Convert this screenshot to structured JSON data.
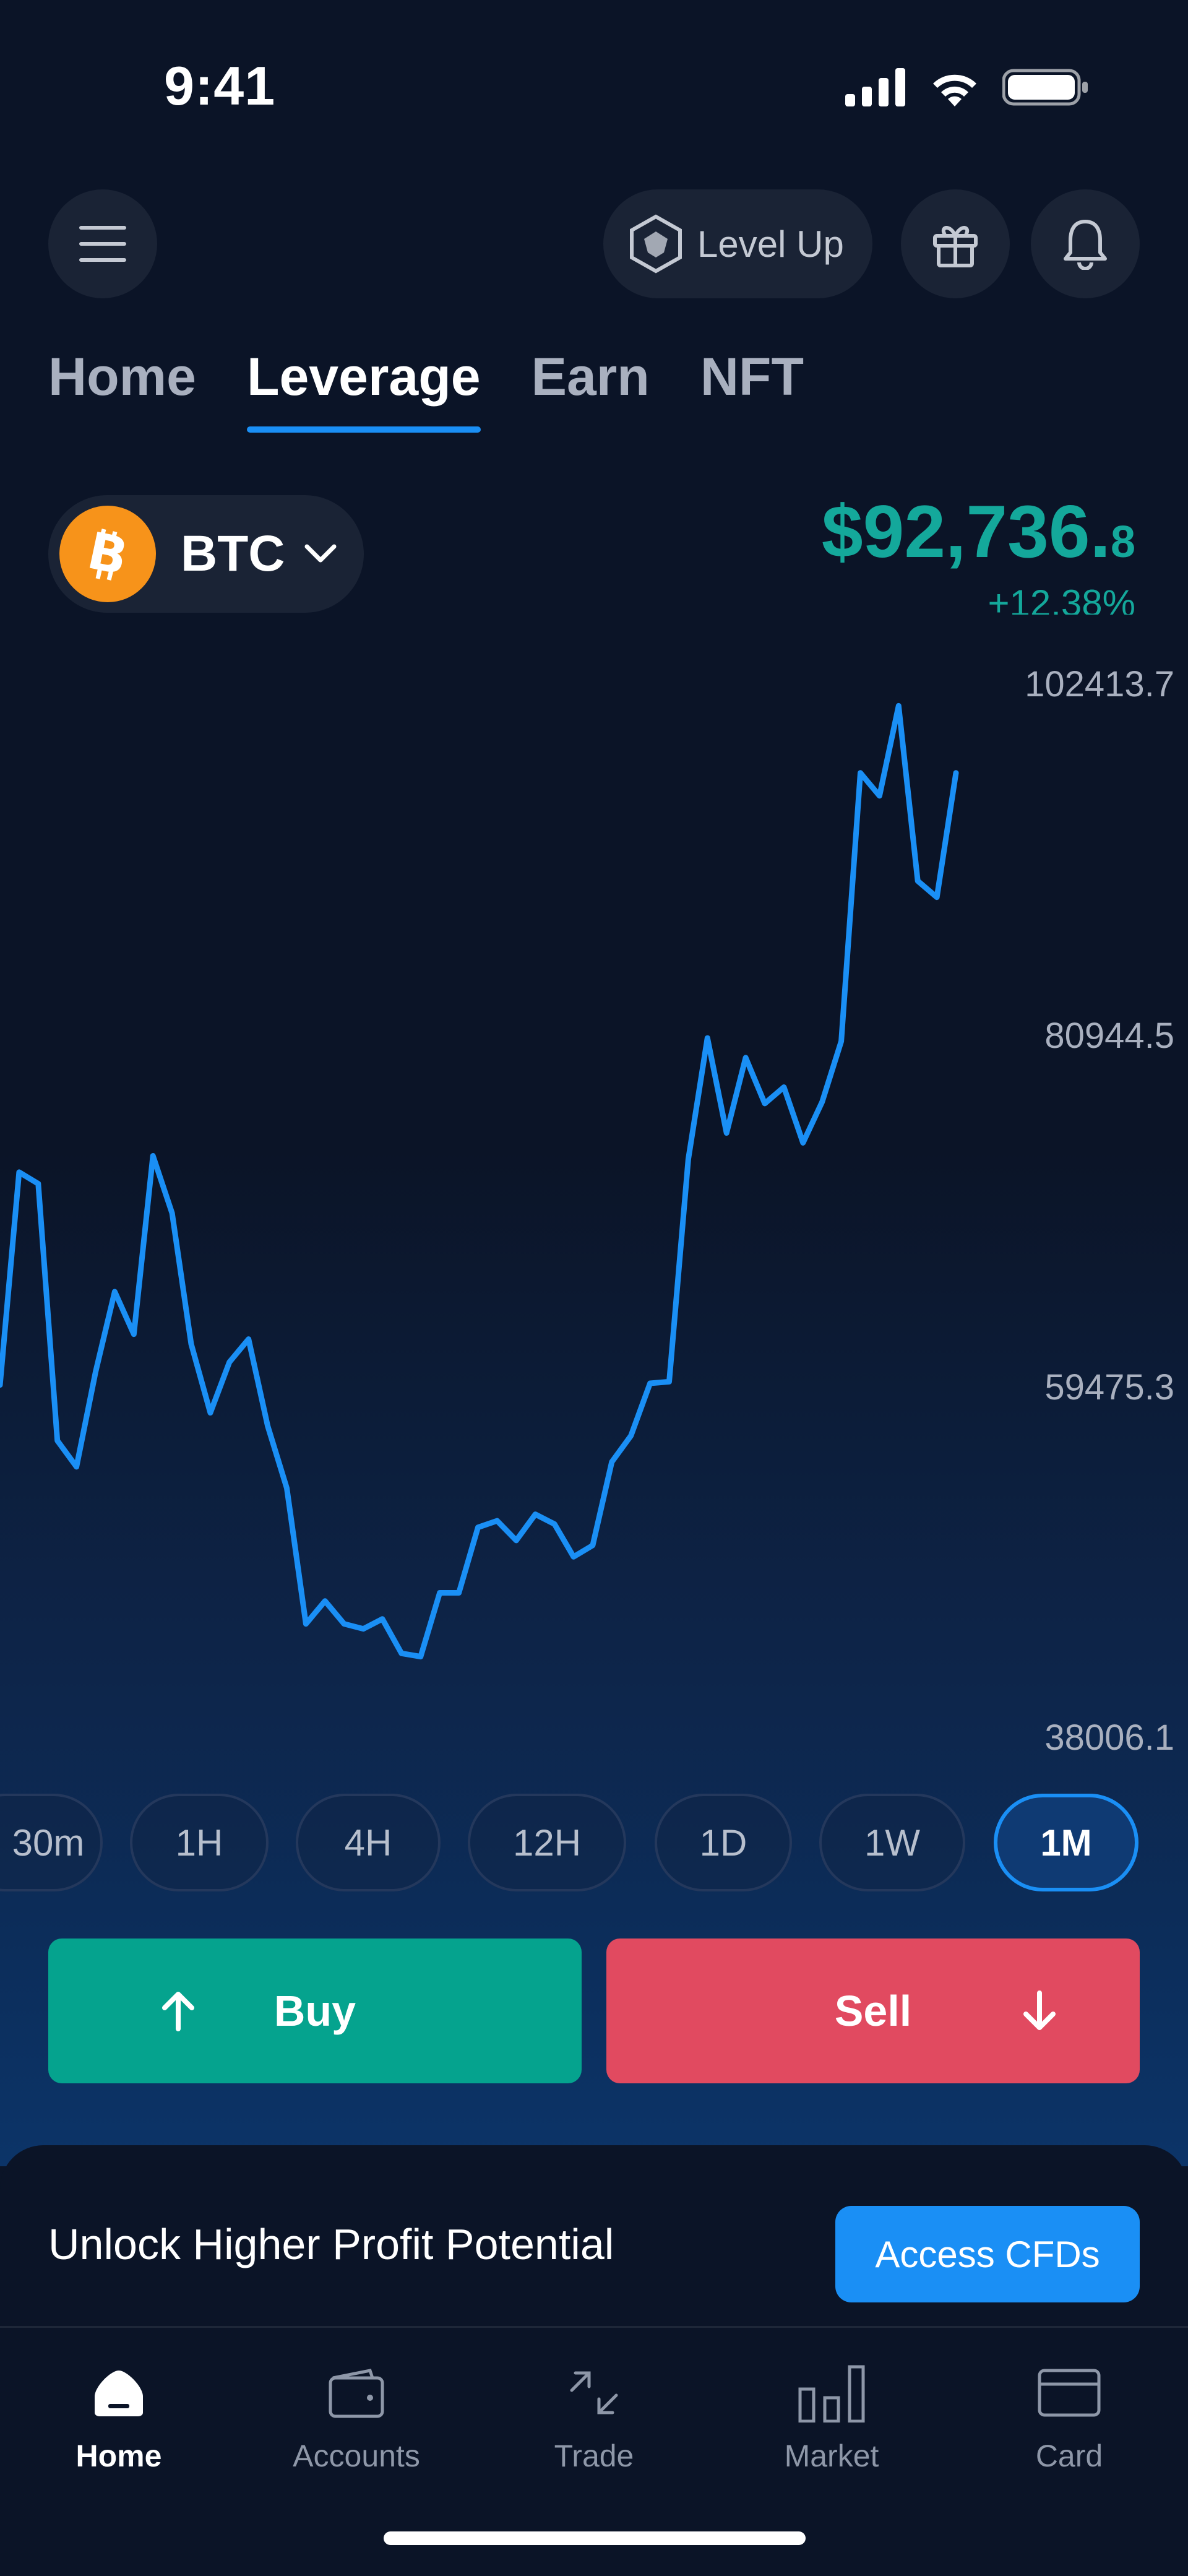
{
  "status_bar": {
    "time": "9:41"
  },
  "header": {
    "level_up_label": "Level Up"
  },
  "tabs": [
    {
      "label": "Home",
      "active": false
    },
    {
      "label": "Leverage",
      "active": true
    },
    {
      "label": "Earn",
      "active": false
    },
    {
      "label": "NFT",
      "active": false
    }
  ],
  "coin": {
    "symbol": "BTC",
    "icon": "bitcoin-icon"
  },
  "price": {
    "main": "$92,736.",
    "decimal": "8",
    "change": "+12.38%",
    "color": "#14a89b"
  },
  "chart_data": {
    "type": "line",
    "title": "",
    "xlabel": "",
    "ylabel": "",
    "y_ticks": [
      "102413.7",
      "80944.5",
      "59475.3",
      "38006.1"
    ],
    "ylim": [
      38006.1,
      102413.7
    ],
    "series": [
      {
        "color": "#1a8ff5",
        "values": [
          59500,
          72500,
          71800,
          56100,
          54500,
          60300,
          65200,
          62600,
          73500,
          70000,
          62000,
          57800,
          60900,
          62300,
          57000,
          53200,
          44900,
          46300,
          44900,
          44600,
          45200,
          43100,
          42900,
          46800,
          46800,
          50800,
          51200,
          50000,
          51600,
          51000,
          49000,
          49700,
          54800,
          56400,
          59600,
          59700,
          73300,
          80700,
          74900,
          79500,
          76700,
          77700,
          74300,
          76800,
          80500,
          96900,
          95500,
          101000,
          90300,
          89300,
          96900
        ]
      }
    ]
  },
  "timeframes": [
    {
      "label": "30m",
      "active": false
    },
    {
      "label": "1H",
      "active": false
    },
    {
      "label": "4H",
      "active": false
    },
    {
      "label": "12H",
      "active": false
    },
    {
      "label": "1D",
      "active": false
    },
    {
      "label": "1W",
      "active": false
    },
    {
      "label": "1M",
      "active": true
    }
  ],
  "actions": {
    "buy_label": "Buy",
    "sell_label": "Sell",
    "buy_color": "#05a38e",
    "sell_color": "#e14a60"
  },
  "promo": {
    "text": "Unlock Higher Profit Potential",
    "button_label": "Access CFDs"
  },
  "bottom_nav": [
    {
      "label": "Home",
      "icon": "home-icon",
      "active": true
    },
    {
      "label": "Accounts",
      "icon": "wallet-icon",
      "active": false
    },
    {
      "label": "Trade",
      "icon": "trade-arrows-icon",
      "active": false
    },
    {
      "label": "Market",
      "icon": "bar-chart-icon",
      "active": false
    },
    {
      "label": "Card",
      "icon": "card-icon",
      "active": false
    }
  ]
}
